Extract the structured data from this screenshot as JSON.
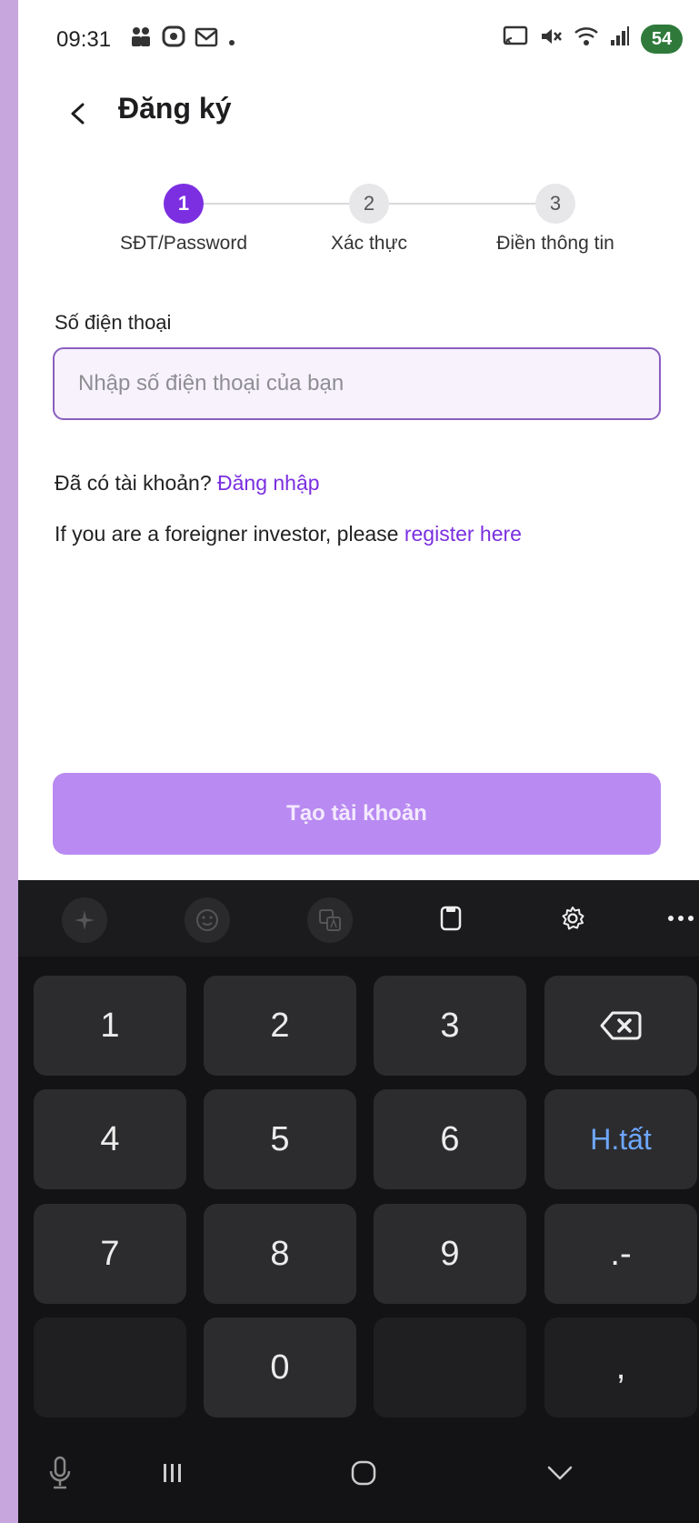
{
  "status_bar": {
    "time": "09:31",
    "battery": "54"
  },
  "header": {
    "title": "Đăng ký"
  },
  "stepper": {
    "steps": [
      {
        "number": "1",
        "label": "SĐT/Password",
        "active": true
      },
      {
        "number": "2",
        "label": "Xác thực",
        "active": false
      },
      {
        "number": "3",
        "label": "Điền thông tin",
        "active": false
      }
    ]
  },
  "form": {
    "phone_label": "Số điện thoại",
    "phone_placeholder": "Nhập số điện thoại của bạn",
    "phone_value": ""
  },
  "login_prompt": {
    "text": "Đã có tài khoản?",
    "link": "Đăng nhập"
  },
  "foreigner_prompt": {
    "text": "If you are a foreigner investor, please",
    "link": "register here"
  },
  "submit_button": {
    "label": "Tạo tài khoản"
  },
  "keyboard": {
    "toolbar_icons": [
      "sparkle-icon",
      "emoji-icon",
      "translate-icon",
      "clipboard-icon",
      "settings-icon",
      "more-icon"
    ],
    "keys": {
      "k1": "1",
      "k2": "2",
      "k3": "3",
      "k4": "4",
      "k5": "5",
      "k6": "6",
      "done": "H.tất",
      "k7": "7",
      "k8": "8",
      "k9": "9",
      "dotdash": ".-",
      "k0": "0",
      "comma": ","
    }
  },
  "colors": {
    "accent": "#7b2fe0",
    "button_disabled": "#b98af2",
    "input_border": "#8a5ec0",
    "background_frame": "#c6a6dc",
    "keyboard_bg": "#131315",
    "key_bg": "#2c2c2f",
    "done_key_text": "#6ea7ff"
  }
}
